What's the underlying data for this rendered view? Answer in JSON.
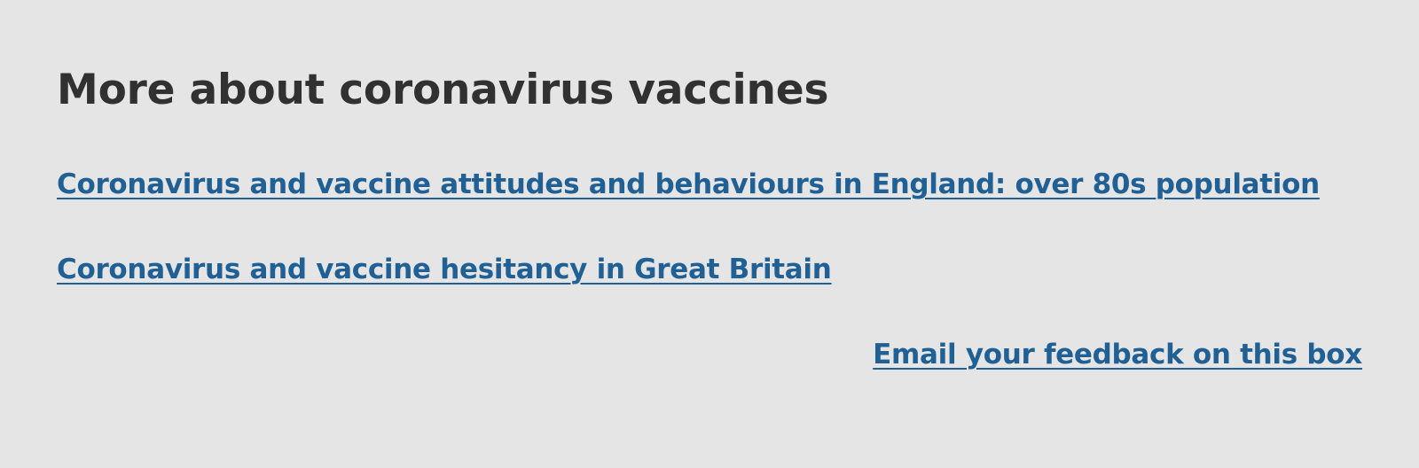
{
  "panel": {
    "title": "More about coronavirus vaccines",
    "links": [
      {
        "label": "Coronavirus and vaccine attitudes and behaviours in England: over 80s population"
      },
      {
        "label": "Coronavirus and vaccine hesitancy in Great Britain"
      }
    ],
    "feedback_label": "Email your feedback on this box"
  },
  "colors": {
    "background": "#e5e5e5",
    "title": "#323132",
    "link": "#206095"
  }
}
